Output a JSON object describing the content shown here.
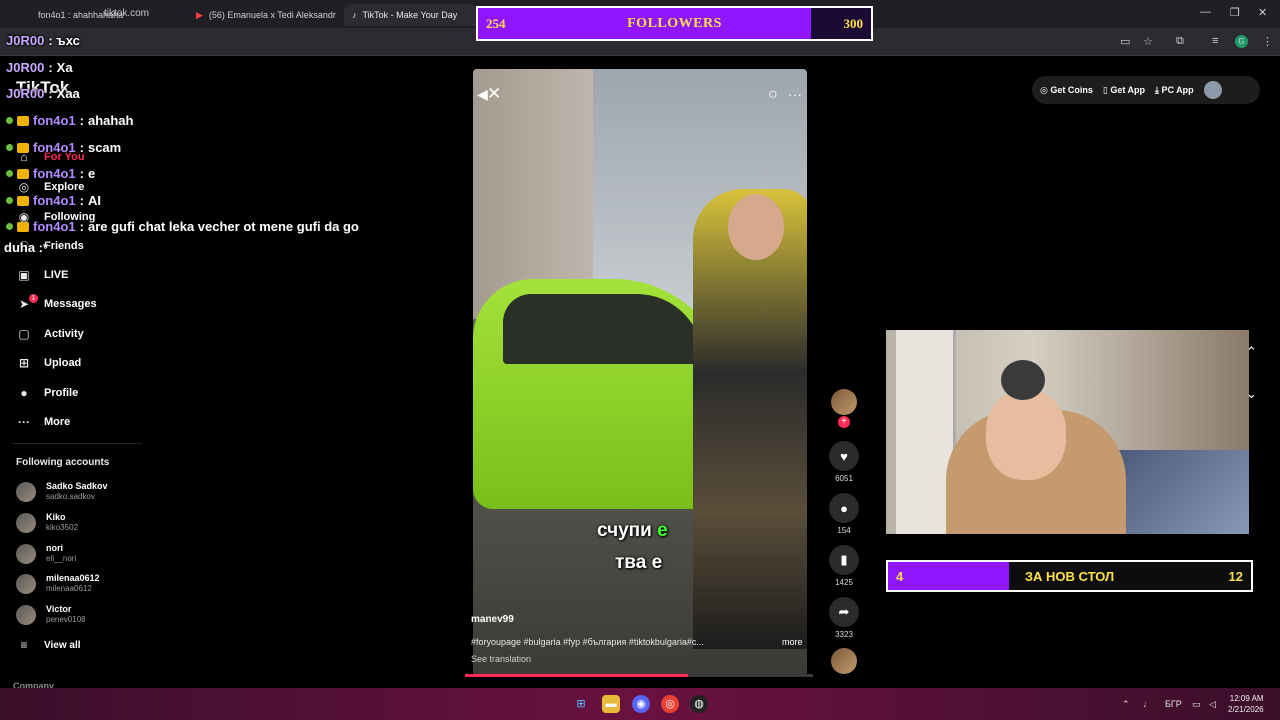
{
  "browser": {
    "tabs": [
      {
        "title": "fon4o1 : ahahhahaha",
        "active": false
      },
      {
        "title": "(56) Emanuela x Tedi Aleksandr",
        "active": false
      },
      {
        "title": "TikTok - Make Your Day",
        "active": true
      }
    ],
    "url": "tiktok.com",
    "profile_initial": "G"
  },
  "chat": {
    "lines": [
      {
        "user": "J0R00",
        "message": "Xa"
      },
      {
        "user": "J0R00",
        "message": "Xaa"
      },
      {
        "user": "fon4o1",
        "message": "ahahah"
      },
      {
        "user": "fon4o1",
        "message": "scam"
      },
      {
        "user": "fon4o1",
        "message": "e"
      },
      {
        "user": "fon4o1",
        "message": "AI"
      },
      {
        "user": "fon4o1",
        "message": "are gufi chat leka vecher ot mene gufi da go"
      },
      {
        "user": "",
        "message": "duha :*"
      }
    ],
    "header_user": "J0R00",
    "header_text": ": ъхс"
  },
  "sidebar": {
    "logo": "TikTok",
    "nav": [
      {
        "label": "For You",
        "icon": "home-icon"
      },
      {
        "label": "Explore",
        "icon": "compass-icon"
      },
      {
        "label": "Following",
        "icon": "following-icon"
      },
      {
        "label": "Friends",
        "icon": "friends-icon"
      },
      {
        "label": "LIVE",
        "icon": "live-icon"
      },
      {
        "label": "Messages",
        "icon": "messages-icon",
        "badge": "1"
      },
      {
        "label": "Activity",
        "icon": "activity-icon"
      },
      {
        "label": "Upload",
        "icon": "upload-icon"
      },
      {
        "label": "Profile",
        "icon": "profile-icon"
      },
      {
        "label": "More",
        "icon": "more-icon"
      }
    ],
    "following_title": "Following accounts",
    "accounts": [
      {
        "name": "Sadko Sadkov",
        "handle": "sadko.sadkov"
      },
      {
        "name": "Kiko",
        "handle": "kiko3502"
      },
      {
        "name": "nori",
        "handle": "eli__nori"
      },
      {
        "name": "milenaa0612",
        "handle": "milenaa0612"
      },
      {
        "name": "Victor",
        "handle": "penev0108"
      }
    ],
    "view_all": "View all",
    "company": "Company"
  },
  "video": {
    "caption_line1": "счупи",
    "caption_line1_green": "е",
    "caption_line2": "тва е",
    "author": "manev99",
    "tags": "#foryoupage #bulgaria #fyp #българия #tiktokbulgaria#с...",
    "more": "more",
    "see_translation": "See translation",
    "progress": 0.64
  },
  "actions": {
    "likes": "6051",
    "comments": "154",
    "saves": "1425",
    "shares": "3323"
  },
  "topright": {
    "get_coins": "Get Coins",
    "get_app": "Get App",
    "pc_app": "PC App"
  },
  "followers_goal": {
    "current": "254",
    "title": "FOLLOWERS",
    "target": "300",
    "progress": 0.847
  },
  "table_goal": {
    "current": "4",
    "title": "ЗА НОВ СТОЛ",
    "target": "12",
    "progress": 0.333
  },
  "taskbar": {
    "lang": "БГР",
    "time": "12:09 AM",
    "date": "2/21/2026"
  }
}
